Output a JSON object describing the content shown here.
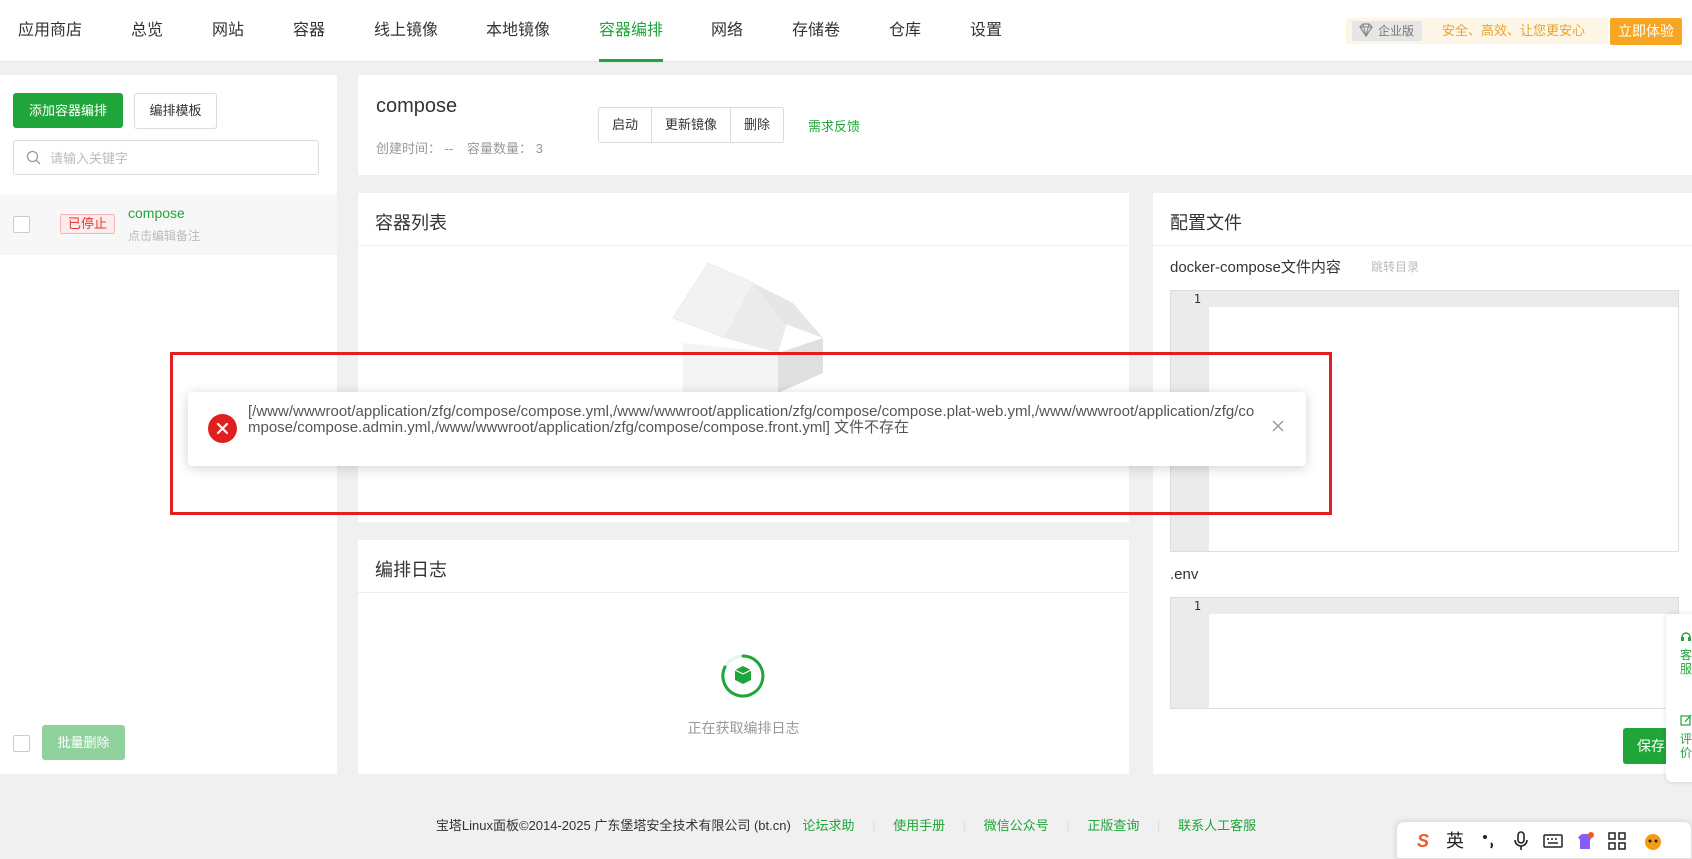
{
  "nav": {
    "tabs": [
      {
        "label": "应用商店"
      },
      {
        "label": "总览"
      },
      {
        "label": "网站"
      },
      {
        "label": "容器"
      },
      {
        "label": "线上镜像"
      },
      {
        "label": "本地镜像"
      },
      {
        "label": "容器编排"
      },
      {
        "label": "网络"
      },
      {
        "label": "存储卷"
      },
      {
        "label": "仓库"
      },
      {
        "label": "设置"
      }
    ],
    "active_tab": "容器编排",
    "enterprise_badge": "企业版",
    "slogan": "安全、高效、让您更安心",
    "try_button": "立即体验"
  },
  "sidebar": {
    "add_button": "添加容器编排",
    "template_button": "编排模板",
    "search_placeholder": "请输入关键字",
    "items": [
      {
        "status": "已停止",
        "name": "compose",
        "note": "点击编辑备注"
      }
    ],
    "batch_delete": "批量删除"
  },
  "header": {
    "title": "compose",
    "created_label": "创建时间：",
    "created_value": "--",
    "count_label": "容量数量：",
    "count_value": "3",
    "actions": {
      "start": "启动",
      "update_image": "更新镜像",
      "delete": "删除"
    },
    "feedback": "需求反馈"
  },
  "container_list": {
    "title": "容器列表"
  },
  "compose_log": {
    "title": "编排日志",
    "loading": "正在获取编排日志"
  },
  "config": {
    "title": "配置文件",
    "compose_label": "docker-compose文件内容",
    "jump_link": "跳转目录",
    "env_label": ".env",
    "line_number": "1",
    "save_button": "保存"
  },
  "toast": {
    "message": "[/www/wwwroot/application/zfg/compose/compose.yml,/www/wwwroot/application/zfg/compose/compose.plat-web.yml,/www/wwwroot/application/zfg/compose/compose.admin.yml,/www/wwwroot/application/zfg/compose/compose.front.yml] 文件不存在"
  },
  "footer": {
    "copyright": "宝塔Linux面板©2014-2025 广东堡塔安全技术有限公司 (bt.cn)",
    "links": [
      "论坛求助",
      "使用手册",
      "微信公众号",
      "正版查询",
      "联系人工客服"
    ]
  },
  "float": {
    "service": "客服",
    "review": "评价"
  },
  "ime": {
    "lang": "英"
  },
  "colors": {
    "accent": "#20a53a",
    "error": "#e02020",
    "warning": "#f6a623"
  }
}
